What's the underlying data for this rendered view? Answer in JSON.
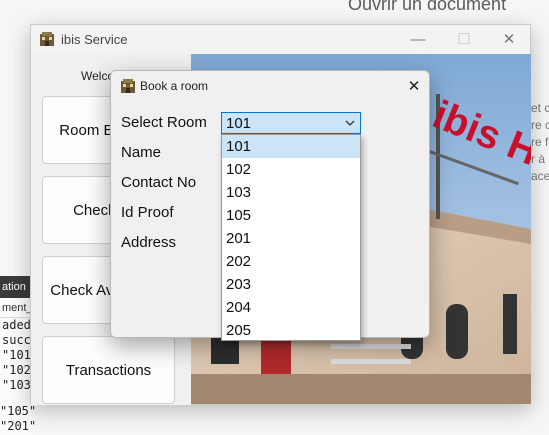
{
  "background": {
    "heading": "Ouvrir un document",
    "right_panel_lines": [
      "et c",
      "re cl",
      "re fc",
      "r à",
      "acer"
    ],
    "console": {
      "tab_label": "ation",
      "sub_label": "ment_",
      "lines": [
        "aded",
        "succe",
        "\"101",
        "\"102",
        "\"103"
      ],
      "tail_lines": [
        "\"105\"",
        "\"201\""
      ]
    }
  },
  "main_window": {
    "title": "ibis Service",
    "minimize_glyph": "—",
    "maximize_glyph": "☐",
    "close_glyph": "✕",
    "welcome_text": "Welcome",
    "buttons": {
      "room_booking": "Room Booking",
      "checkout": "Check Out",
      "check_availability": "Check Availability",
      "transactions": "Transactions"
    },
    "photo": {
      "sign_text": "ibis HOTEL",
      "awning_text": "ibis"
    }
  },
  "dialog": {
    "title": "Book a room",
    "close_glyph": "✕",
    "labels": {
      "select_room": "Select Room",
      "name": "Name",
      "contact_no": "Contact No",
      "id_proof": "Id Proof",
      "address": "Address"
    },
    "room_select": {
      "value": "101",
      "options": [
        "101",
        "102",
        "103",
        "105",
        "201",
        "202",
        "203",
        "204",
        "205"
      ],
      "highlighted": "101"
    }
  },
  "colors": {
    "selection_bg": "#cce4f7",
    "focus_border": "#0078d4",
    "brand_red": "#c8102e"
  }
}
